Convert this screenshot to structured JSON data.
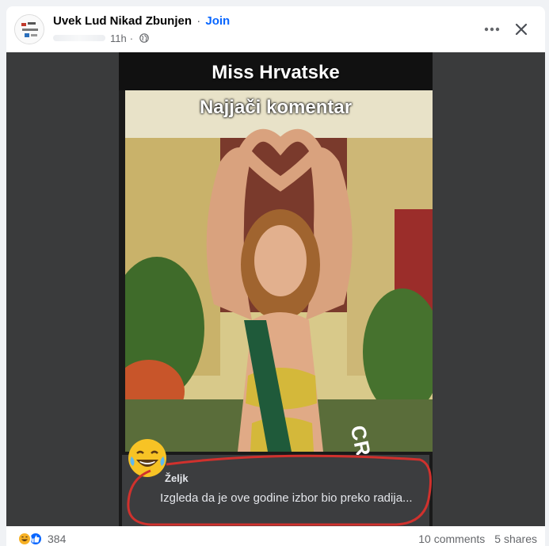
{
  "post": {
    "group_name": "Uvek Lud Nikad Zbunjen",
    "separator": "·",
    "join_label": "Join",
    "time": "11h",
    "meta_separator": "·",
    "privacy_icon": "globe-icon",
    "more_icon": "more-horizontal-icon",
    "close_icon": "close-icon"
  },
  "image": {
    "title": "Miss Hrvatske",
    "subtitle": "Najjači komentar",
    "sash_text": "CROATIA",
    "comment": {
      "author": "Željk",
      "text": "Izgleda da je ove godine izbor bio preko radija...",
      "emoji": "laughing-tears-emoji"
    }
  },
  "footer": {
    "reaction_icons": [
      "haha-reaction-icon",
      "like-reaction-icon"
    ],
    "reaction_count": "384",
    "comments": "10 comments",
    "shares": "5 shares"
  },
  "colors": {
    "join": "#0866ff",
    "like": "#0866ff",
    "haha": "#f7b125",
    "media_bg": "#3a3b3c",
    "annotation_red": "#d0312d"
  }
}
